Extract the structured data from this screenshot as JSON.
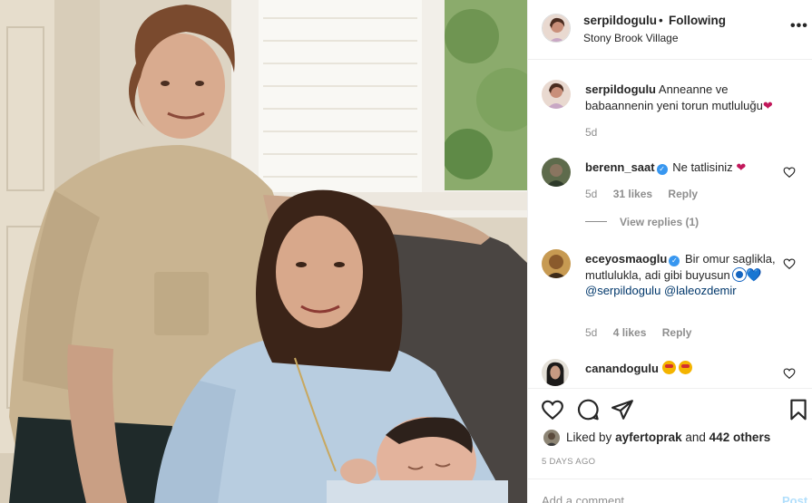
{
  "post": {
    "username": "serpildogulu",
    "separator": "•",
    "follow_label": "Following",
    "location": "Stony Brook Village",
    "more_label": "•••"
  },
  "caption": {
    "username": "serpildogulu",
    "text": "Anneanne ve babaannenin yeni torun mutluluğu",
    "emoji": "❤",
    "time": "5d"
  },
  "comments": [
    {
      "username": "berenn_saat",
      "verified": true,
      "text": "Ne tatlisiniz",
      "emoji": "❤",
      "time": "5d",
      "likes": "31 likes",
      "reply_label": "Reply",
      "view_replies": "View replies (1)"
    },
    {
      "username": "eceyosmaoglu",
      "verified": true,
      "text": "Bir omur saglikla, mutlulukla, adi gibi buyusun",
      "emoji": "💙",
      "mention1": "@serpildogulu",
      "mention2": "@laleozdemir",
      "time": "5d",
      "likes": "4 likes",
      "reply_label": "Reply"
    },
    {
      "username": "canandogulu",
      "verified": false,
      "text": ""
    }
  ],
  "liked_by": {
    "prefix": "Liked by",
    "user": "ayfertoprak",
    "and": "and",
    "others": "442 others"
  },
  "time_ago": "5 DAYS AGO",
  "comment_box": {
    "placeholder": "Add a comment...",
    "post_label": "Post"
  },
  "icons": {
    "like": "heart-outline-icon",
    "comment": "speech-bubble-icon",
    "share": "paper-plane-icon",
    "save": "bookmark-icon",
    "more": "ellipsis-icon"
  },
  "colors": {
    "link": "#00376b",
    "verified": "#3897f0",
    "muted": "#8e8e8e",
    "post_button": "#b2dffc"
  }
}
